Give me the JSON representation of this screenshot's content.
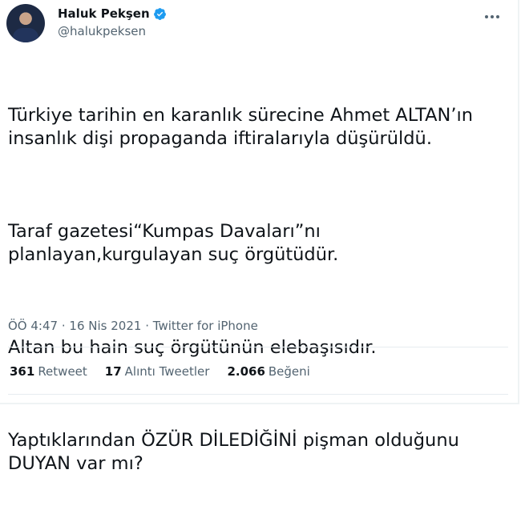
{
  "author": {
    "name": "Haluk Pekşen",
    "handle": "@halukpeksen",
    "verified_color": "#1d9bf0"
  },
  "tweet": {
    "paragraphs": [
      "Türkiye tarihin en karanlık sürecine Ahmet ALTAN’ın insanlık dişi propaganda iftiralarıyla düşürüldü.",
      "Taraf gazetesi“Kumpas Davaları”nı planlayan,kurgulayan suç örgütüdür.",
      "Altan bu hain suç örgütünün elebaşısıdır.",
      "Yaptıklarından ÖZÜR DİLEDİĞİNİ pişman olduğunu DUYAN var mı?"
    ]
  },
  "meta": {
    "time": "ÖÖ 4:47",
    "separator": "·",
    "date": "16 Nis 2021",
    "source": "Twitter for iPhone"
  },
  "stats": [
    {
      "count": "361",
      "label": "Retweet"
    },
    {
      "count": "17",
      "label": "Alıntı Tweetler"
    },
    {
      "count": "2.066",
      "label": "Beğeni"
    }
  ]
}
